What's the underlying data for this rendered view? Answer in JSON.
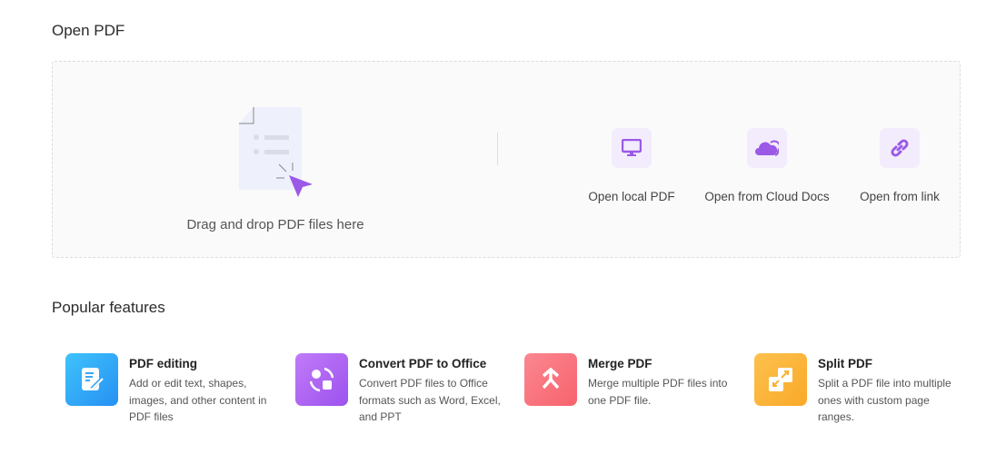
{
  "open_pdf": {
    "title": "Open PDF",
    "drag_text": "Drag and drop PDF files here",
    "options": [
      {
        "label": "Open local PDF",
        "icon": "monitor-icon"
      },
      {
        "label": "Open from Cloud Docs",
        "icon": "cloud-icon"
      },
      {
        "label": "Open from link",
        "icon": "link-icon"
      }
    ]
  },
  "popular": {
    "title": "Popular features",
    "features": [
      {
        "title": "PDF editing",
        "desc": "Add or edit text, shapes, images, and other content in PDF files",
        "color": "#2e9cf5"
      },
      {
        "title": "Convert PDF to Office",
        "desc": "Convert PDF files to Office formats such as Word, Excel, and PPT",
        "color": "#a35cf0"
      },
      {
        "title": "Merge PDF",
        "desc": "Merge multiple PDF files into one PDF file.",
        "color": "#f86a74"
      },
      {
        "title": "Split PDF",
        "desc": "Split a PDF file into multiple ones with custom page ranges.",
        "color": "#fbb033"
      }
    ]
  },
  "accent": "#9b59e6"
}
